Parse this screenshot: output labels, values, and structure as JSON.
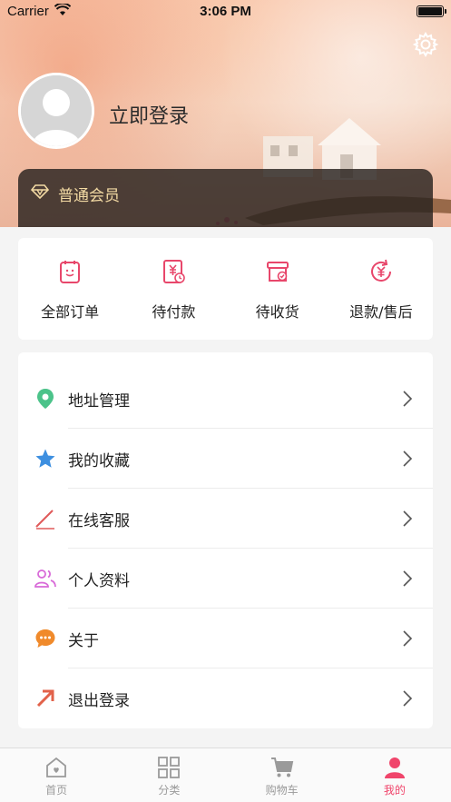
{
  "status_bar": {
    "carrier": "Carrier",
    "time": "3:06 PM"
  },
  "profile": {
    "login_text": "立即登录",
    "member_label": "普通会员"
  },
  "orders": [
    {
      "label": "全部订单",
      "icon": "clipboard-icon"
    },
    {
      "label": "待付款",
      "icon": "payment-icon"
    },
    {
      "label": "待收货",
      "icon": "package-icon"
    },
    {
      "label": "退款/售后",
      "icon": "refund-icon"
    }
  ],
  "menu": [
    {
      "label": "地址管理",
      "icon": "location-pin-icon",
      "color": "#4cc38a"
    },
    {
      "label": "我的收藏",
      "icon": "star-icon",
      "color": "#3d8fe0"
    },
    {
      "label": "在线客服",
      "icon": "pen-icon",
      "color": "#e05a5a"
    },
    {
      "label": "个人资料",
      "icon": "people-icon",
      "color": "#d86ad8"
    },
    {
      "label": "关于",
      "icon": "chat-bubble-icon",
      "color": "#f08a2b"
    },
    {
      "label": "退出登录",
      "icon": "arrow-out-icon",
      "color": "#e2624a"
    }
  ],
  "tabbar": [
    {
      "label": "首页",
      "icon": "home-icon",
      "active": false
    },
    {
      "label": "分类",
      "icon": "grid-icon",
      "active": false
    },
    {
      "label": "购物车",
      "icon": "cart-icon",
      "active": false
    },
    {
      "label": "我的",
      "icon": "user-icon",
      "active": true
    }
  ],
  "colors": {
    "accent": "#f0456b",
    "member_gold": "#f2d9a3",
    "order_icon": "#e8476b"
  }
}
